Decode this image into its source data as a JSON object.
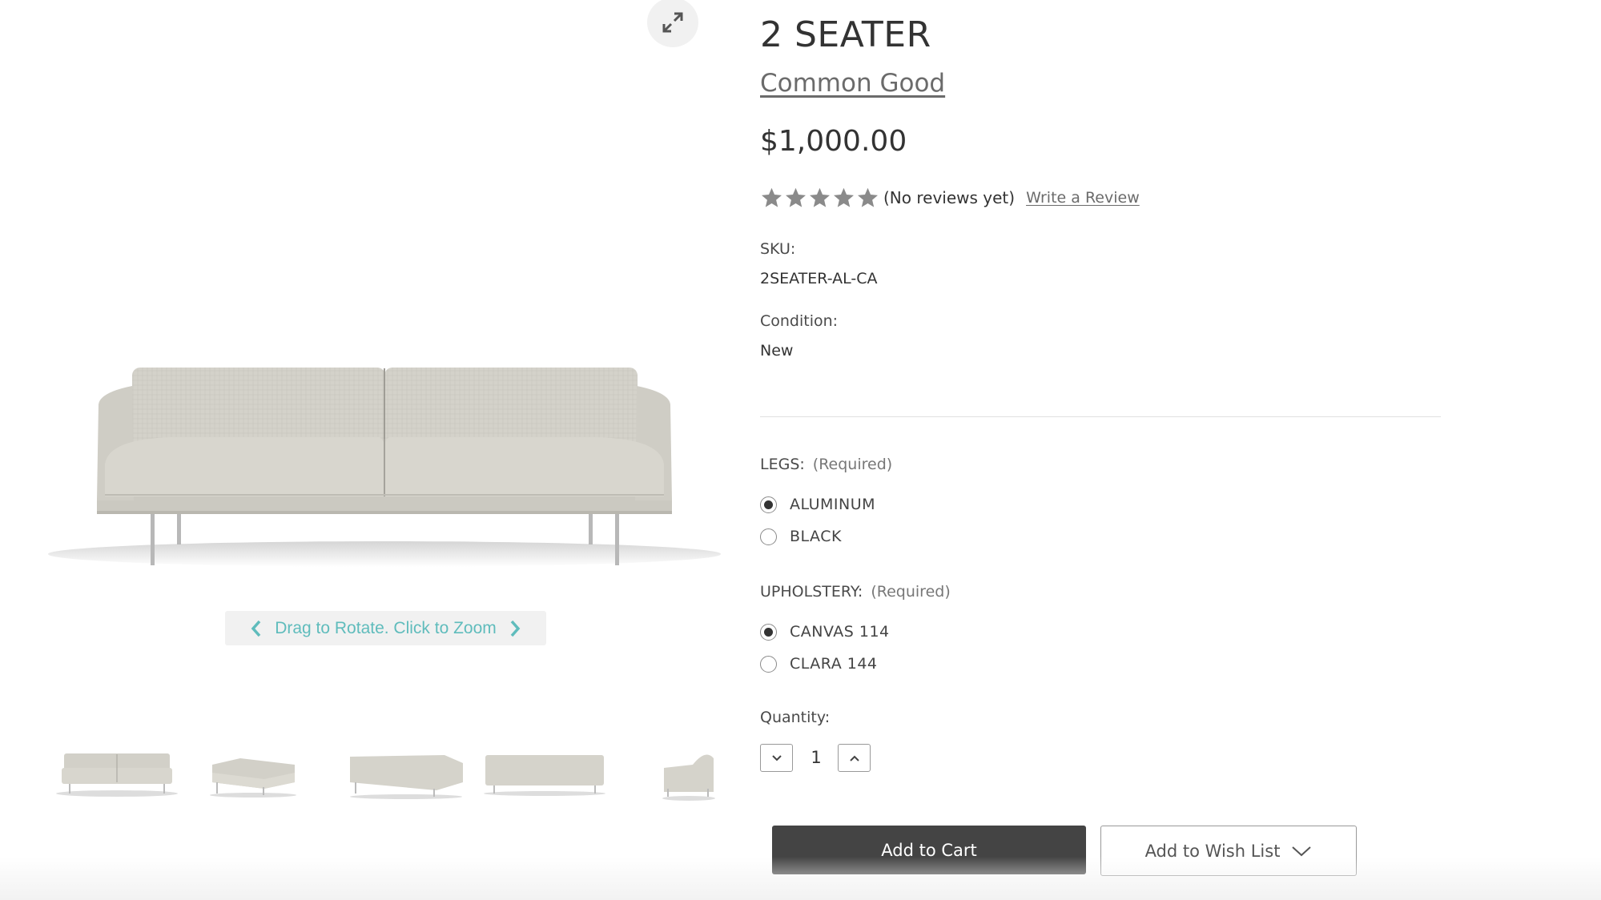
{
  "product": {
    "title": "2 SEATER",
    "brand": "Common Good",
    "price": "$1,000.00",
    "rating": {
      "stars": 5,
      "filled": 0,
      "reviews_label": "(No reviews yet)",
      "write_review": "Write a Review"
    },
    "sku_label": "SKU:",
    "sku": "2SEATER-AL-CA",
    "condition_label": "Condition:",
    "condition": "New"
  },
  "gallery": {
    "rotate_hint": "Drag to Rotate. Click to Zoom",
    "expand_icon": "expand-icon",
    "thumbnails": [
      "front-view",
      "angle-left-view",
      "back-angle-view",
      "back-view",
      "side-view"
    ]
  },
  "options": {
    "legs": {
      "label": "LEGS:",
      "required": "(Required)",
      "choices": [
        {
          "label": "ALUMINUM",
          "selected": true
        },
        {
          "label": "BLACK",
          "selected": false
        }
      ]
    },
    "upholstery": {
      "label": "UPHOLSTERY:",
      "required": "(Required)",
      "choices": [
        {
          "label": "CANVAS 114",
          "selected": true
        },
        {
          "label": "CLARA 144",
          "selected": false
        }
      ]
    }
  },
  "quantity": {
    "label": "Quantity:",
    "value": "1"
  },
  "actions": {
    "add_to_cart": "Add to Cart",
    "add_to_wish_list": "Add to Wish List"
  },
  "colors": {
    "accent_teal": "#5fbcbc",
    "cart_button": "#444444",
    "sofa_fabric": "#d2d0c8"
  }
}
